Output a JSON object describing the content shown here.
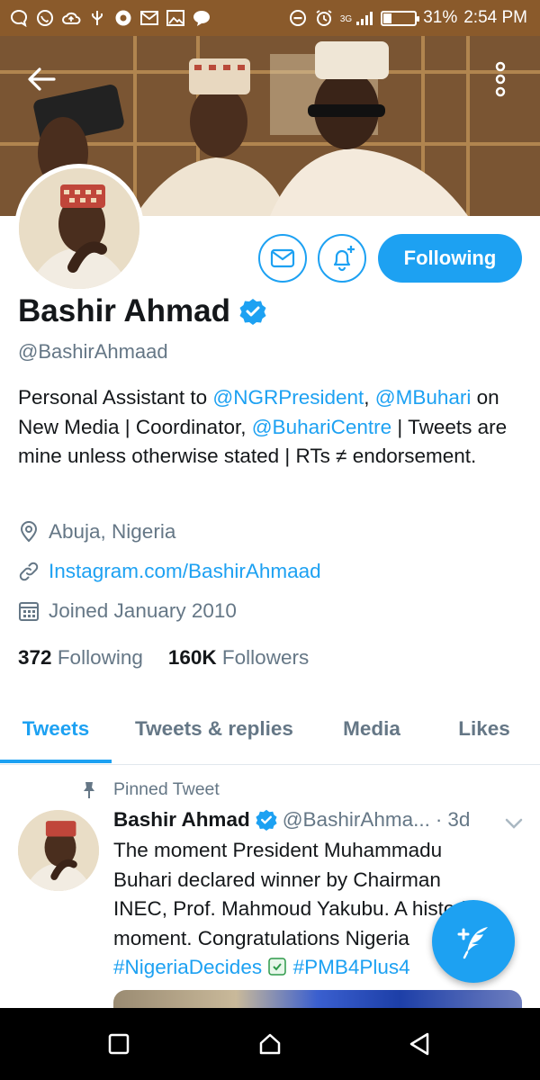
{
  "status_bar": {
    "battery_percent": "31%",
    "battery_level": 0.31,
    "time": "2:54 PM",
    "network": "3G",
    "left_icons": [
      "chat-bubble-icon",
      "whatsapp-icon",
      "cloud-upload-icon",
      "usb-icon",
      "chrome-icon",
      "gmail-icon",
      "image-icon",
      "message-icon"
    ],
    "right_icons": [
      "do-not-disturb-icon",
      "alarm-icon",
      "signal-icon",
      "battery-icon"
    ]
  },
  "header": {
    "back_icon": "arrow-left-icon",
    "more_icon": "more-vertical-icon"
  },
  "profile": {
    "name": "Bashir Ahmad",
    "verified": true,
    "handle": "@BashirAhmaad",
    "bio_parts": {
      "p1": "Personal Assistant to ",
      "m1": "@NGRPresident",
      "p2": ", ",
      "m2": "@MBuhari",
      "p3": " on New Media | Coordinator, ",
      "m3": "@BuhariCentre",
      "p4": " | Tweets are mine unless otherwise stated | RTs ≠ endorsement."
    },
    "location": "Abuja, Nigeria",
    "website": "Instagram.com/BashirAhmaad",
    "joined": "Joined January 2010",
    "following_count": "372",
    "following_label": "Following",
    "followers_count": "160K",
    "followers_label": "Followers"
  },
  "actions": {
    "message_icon": "envelope-icon",
    "notify_icon": "bell-plus-icon",
    "follow_label": "Following"
  },
  "tabs": [
    {
      "label": "Tweets",
      "active": true
    },
    {
      "label": "Tweets & replies",
      "active": false
    },
    {
      "label": "Media",
      "active": false
    },
    {
      "label": "Likes",
      "active": false
    }
  ],
  "pinned_tweet": {
    "pinned_label": "Pinned Tweet",
    "name": "Bashir Ahmad",
    "handle": "@BashirAhma...",
    "dot": "·",
    "time": "3d",
    "text_plain": "The moment President Muhammadu Buhari declared winner by Chairman INEC, Prof. Mahmoud Yakubu. A historic moment. Congratulations Nigeria",
    "hashtag1": "#NigeriaDecides",
    "hashtag2": "#PMB4Plus4"
  },
  "fab": {
    "icon": "compose-feather-icon"
  },
  "nav": {
    "icons": [
      "recents-square-icon",
      "home-icon",
      "back-triangle-icon"
    ]
  },
  "colors": {
    "accent": "#1da1f2",
    "text_primary": "#14171a",
    "text_secondary": "#657786",
    "status_bar": "#8a5a2b",
    "nav_bar": "#000000"
  }
}
